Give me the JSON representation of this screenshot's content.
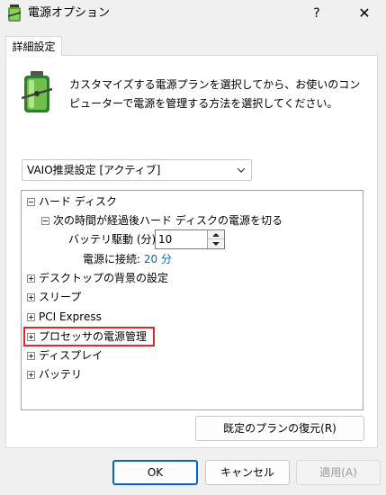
{
  "window": {
    "title": "電源オプション",
    "help_glyph": "?",
    "close_glyph": "✕"
  },
  "tab": {
    "label": "詳細設定"
  },
  "description": "カスタマイズする電源プランを選択してから、お使いのコンピューターで電源を管理する方法を選択してください。",
  "plan_select": {
    "value": "VAIO推奨設定 [アクティブ]"
  },
  "tree": {
    "hard_disk": "ハード ディスク",
    "turn_off_after": "次の時間が経過後ハード ディスクの電源を切る",
    "battery_label": "バッテリ駆動 (分):",
    "battery_value": "10",
    "plugged_label": "電源に接続:",
    "plugged_value": "20 分",
    "desktop_background": "デスクトップの背景の設定",
    "sleep": "スリープ",
    "pci_express": "PCI Express",
    "processor_power": "プロセッサの電源管理",
    "display": "ディスプレイ",
    "battery": "バッテリ"
  },
  "buttons": {
    "restore": "既定のプランの復元(R)",
    "ok": "OK",
    "cancel": "キャンセル",
    "apply": "適用(A)"
  },
  "colors": {
    "accent": "#0066cc",
    "highlight": "#e0262f"
  }
}
